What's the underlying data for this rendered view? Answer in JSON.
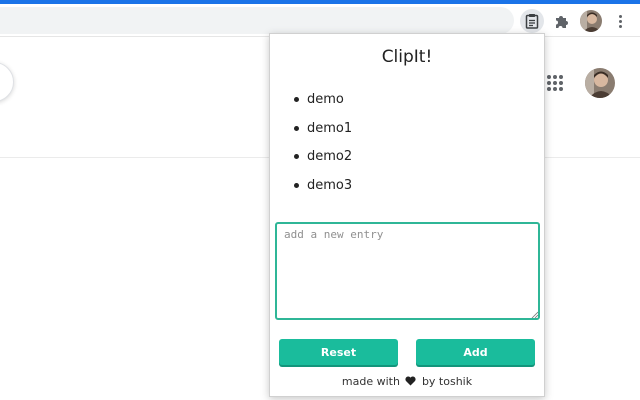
{
  "popup": {
    "title": "ClipIt!",
    "entries": [
      "demo",
      "demo1",
      "demo2",
      "demo3"
    ],
    "input": {
      "value": "",
      "placeholder": "add a new entry"
    },
    "buttons": {
      "reset": "Reset",
      "add": "Add"
    },
    "footer": {
      "prefix": "made with",
      "suffix": "by toshik"
    }
  },
  "toolbar": {
    "icons": [
      "clipboard-icon",
      "puzzle-icon",
      "avatar",
      "more-vert-icon"
    ]
  },
  "page": {
    "icons": [
      "apps-grid-icon",
      "avatar"
    ]
  },
  "colors": {
    "accent": "#1abc9c",
    "input_border": "#2fb697",
    "chrome_blue": "#1a73e8"
  }
}
